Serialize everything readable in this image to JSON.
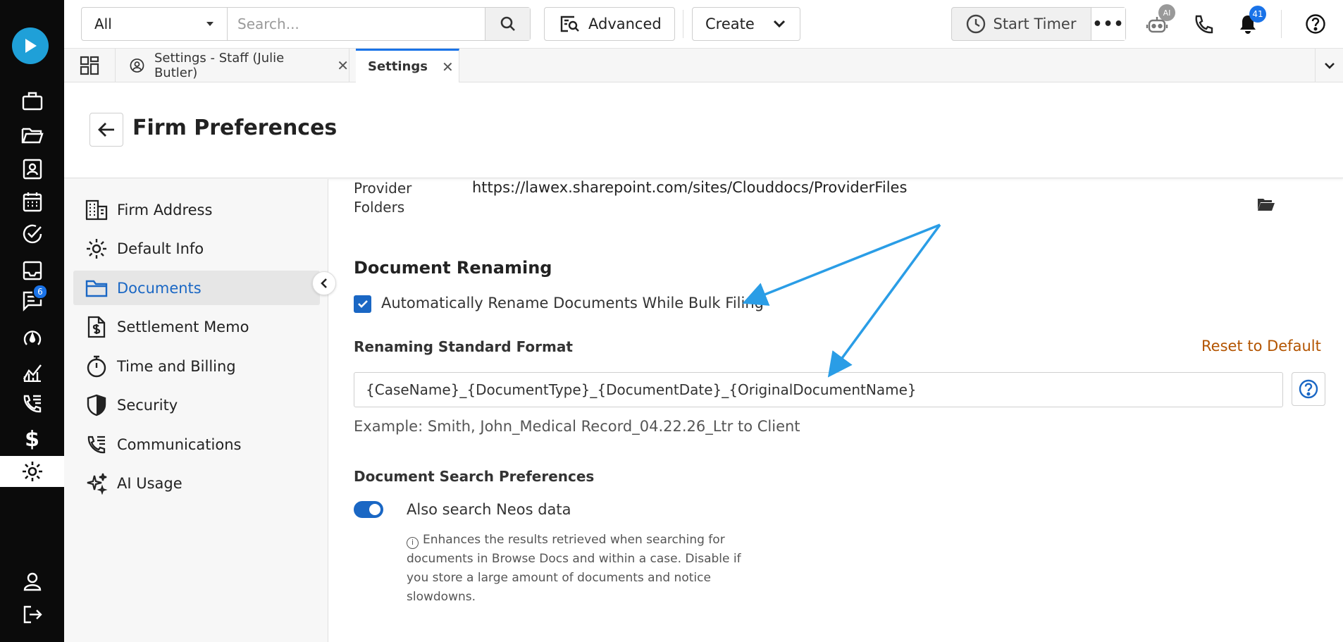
{
  "topbar": {
    "scope_value": "All",
    "search_placeholder": "Search...",
    "advanced_label": "Advanced",
    "create_label": "Create",
    "timer_label": "Start Timer",
    "more_label": "•••",
    "ai_badge": "AI",
    "notifications_count": "41"
  },
  "rail": {
    "messages_badge": "6"
  },
  "tabs": [
    {
      "label": "Settings - Staff (Julie Butler)"
    },
    {
      "label": "Settings"
    }
  ],
  "page": {
    "title": "Firm Preferences"
  },
  "sidenav": {
    "items": [
      {
        "label": "Firm Address"
      },
      {
        "label": "Default Info"
      },
      {
        "label": "Documents"
      },
      {
        "label": "Settlement Memo"
      },
      {
        "label": "Time and Billing"
      },
      {
        "label": "Security"
      },
      {
        "label": "Communications"
      },
      {
        "label": "AI Usage"
      }
    ]
  },
  "content": {
    "provider_label_line1": "Provider",
    "provider_label_line2": "Folders",
    "provider_url": "https://lawex.sharepoint.com/sites/Clouddocs/ProviderFiles",
    "renaming_heading": "Document Renaming",
    "auto_rename_label": "Automatically Rename Documents While Bulk Filing",
    "format_heading": "Renaming Standard Format",
    "reset_label": "Reset to Default",
    "format_value": "{CaseName}_{DocumentType}_{DocumentDate}_{OriginalDocumentName}",
    "example_text": "Example: Smith, John_Medical Record_04.22.26_Ltr to Client",
    "search_heading": "Document Search Preferences",
    "neos_toggle_label": "Also search Neos data",
    "neos_note": "Enhances the results retrieved when searching for documents in Browse Docs and within a case. Disable if you store a large amount of documents and notice slowdowns."
  },
  "colors": {
    "accent": "#1a67c4",
    "reset_link": "#b35400",
    "annotation_arrow": "#2a9de6"
  }
}
